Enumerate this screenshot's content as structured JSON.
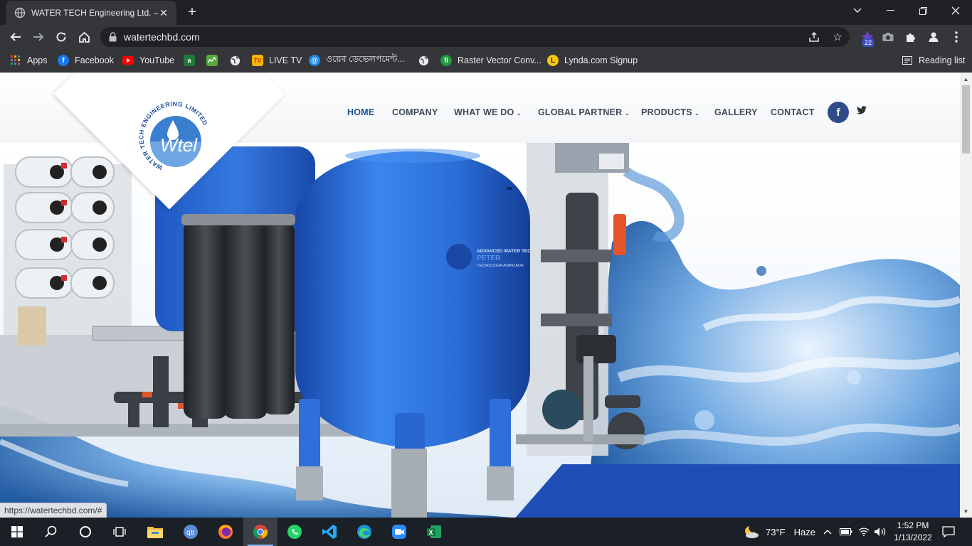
{
  "browser": {
    "tab_title": "WATER TECH Engineering Ltd. – …",
    "url": "watertechbd.com",
    "extension_badge": "22",
    "status_url": "https://watertechbd.com/#"
  },
  "bookmarks": [
    {
      "label": "Apps",
      "icon": "apps-grid-icon"
    },
    {
      "label": "Facebook",
      "icon": "facebook-icon"
    },
    {
      "label": "YouTube",
      "icon": "youtube-icon"
    },
    {
      "label": "",
      "icon": "green-a-icon"
    },
    {
      "label": "",
      "icon": "chart-icon"
    },
    {
      "label": "",
      "icon": "globe-icon"
    },
    {
      "label": "LIVE TV",
      "icon": "livetv-icon"
    },
    {
      "label": "ওয়েব ডেভেলপমেন্ট...",
      "icon": "web-dev-icon"
    },
    {
      "label": "",
      "icon": "globe-icon"
    },
    {
      "label": "Raster Vector Conv...",
      "icon": "rastervector-icon"
    },
    {
      "label": "Lynda.com Signup",
      "icon": "lynda-icon"
    }
  ],
  "reading_list": "Reading list",
  "site": {
    "logo_ring_text": "WATER TECH ENGINEERING LIMITED",
    "logo_mark": "Wtel",
    "nav": [
      {
        "label": "HOME",
        "dropdown": false,
        "active": true
      },
      {
        "label": "COMPANY",
        "dropdown": false,
        "active": false
      },
      {
        "label": "WHAT WE DO",
        "dropdown": true,
        "active": false
      },
      {
        "label": "GLOBAL PARTNER",
        "dropdown": true,
        "active": false
      },
      {
        "label": "PRODUCTS",
        "dropdown": true,
        "active": false
      },
      {
        "label": "GALLERY",
        "dropdown": false,
        "active": false
      },
      {
        "label": "CONTACT",
        "dropdown": false,
        "active": false
      }
    ],
    "social": {
      "facebook": "f",
      "twitter": "twitter-icon"
    },
    "tank_label": "ADVANCED WATER TECH",
    "tank_label2": "PETER",
    "tank_label3": "TECNOLOGIA AVANZADA"
  },
  "taskbar": {
    "weather_temp": "73°F",
    "weather_desc": "Haze",
    "time": "1:52 PM",
    "date": "1/13/2022",
    "apps": [
      "windows-start-icon",
      "search-icon",
      "cortana-icon",
      "task-view-icon",
      "file-explorer-icon",
      "qbittorrent-icon",
      "firefox-icon",
      "chrome-icon",
      "whatsapp-icon",
      "vscode-icon",
      "edge-icon",
      "zoom-icon",
      "excel-icon"
    ]
  },
  "colors": {
    "accent": "#1d4f8f",
    "tank_blue": "#2a6cd6",
    "band_blue": "#1f4fb6"
  }
}
